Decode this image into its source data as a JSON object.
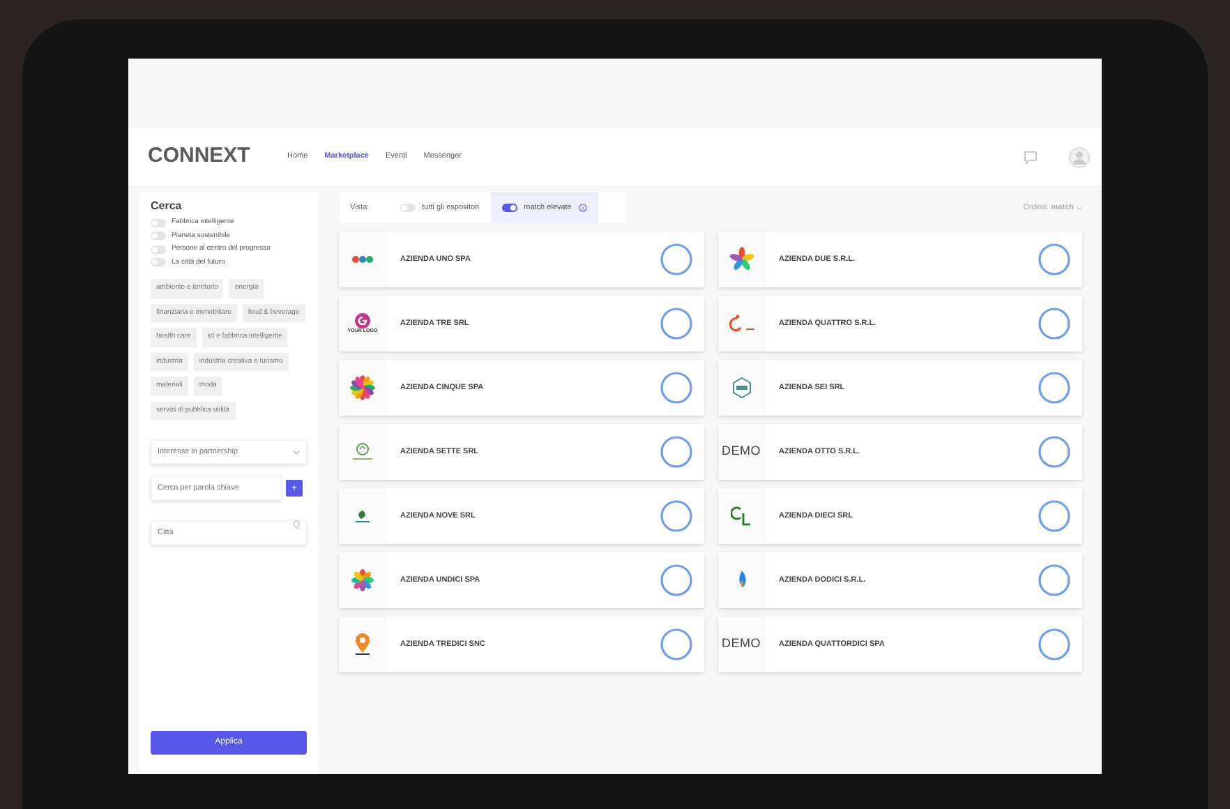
{
  "header": {
    "logo": "CONNEXT",
    "nav": [
      {
        "label": "Home",
        "selected": false
      },
      {
        "label": "Marketplace",
        "selected": true
      },
      {
        "label": "Eventi",
        "selected": false
      },
      {
        "label": "Messenger",
        "selected": false
      }
    ]
  },
  "sidebar": {
    "title": "Cerca",
    "toggles": [
      {
        "label": "Fabbrica intelligente",
        "on": false
      },
      {
        "label": "Pianeta sostenibile",
        "on": false
      },
      {
        "label": "Persone al centro del progresso",
        "on": false
      },
      {
        "label": "La città del futuro",
        "on": false
      }
    ],
    "tags": [
      "ambiente e territorio",
      "energia",
      "finanziaria e immobiliare",
      "food & beverage",
      "health care",
      "ict e fabbrica intelligente",
      "industria",
      "industria creativa e turismo",
      "materiali",
      "moda",
      "servizi di pubblica utilità"
    ],
    "partnership": {
      "placeholder": "Interesse in partnership"
    },
    "keyword": {
      "placeholder": "Cerca per parola chiave",
      "button": "+"
    },
    "city": {
      "placeholder": "Città"
    },
    "apply": "Applica"
  },
  "view": {
    "label": "Vista:",
    "options": [
      {
        "label": "tutti gli espositori",
        "on": false,
        "selected": false
      },
      {
        "label": "match elevate",
        "on": true,
        "selected": true
      }
    ],
    "sort": {
      "label": "Ordina:",
      "value": "match"
    }
  },
  "companies": [
    {
      "name": "AZIENDA UNO SPA",
      "logo": {
        "kind": "dots"
      }
    },
    {
      "name": "AZIENDA DUE S.R.L.",
      "logo": {
        "kind": "petals"
      }
    },
    {
      "name": "AZIENDA TRE SRL",
      "logo": {
        "kind": "letter-g",
        "text": "YOUR LOGO"
      }
    },
    {
      "name": "AZIENDA QUATTRO S.R.L.",
      "logo": {
        "kind": "swirl"
      }
    },
    {
      "name": "AZIENDA CINQUE SPA",
      "logo": {
        "kind": "flower"
      }
    },
    {
      "name": "AZIENDA SEI SRL",
      "logo": {
        "kind": "hexagon"
      }
    },
    {
      "name": "AZIENDA SETTE SRL",
      "logo": {
        "kind": "circle"
      }
    },
    {
      "name": "AZIENDA OTTO S.R.L.",
      "logo": {
        "kind": "wordmark",
        "text": "DEMO"
      }
    },
    {
      "name": "AZIENDA NOVE SRL",
      "logo": {
        "kind": "leaf"
      }
    },
    {
      "name": "AZIENDA DIECI SRL",
      "logo": {
        "kind": "letters"
      }
    },
    {
      "name": "AZIENDA UNDICI SPA",
      "logo": {
        "kind": "pinwheel"
      }
    },
    {
      "name": "AZIENDA DODICI S.R.L.",
      "logo": {
        "kind": "flame"
      }
    },
    {
      "name": "AZIENDA TREDICI SNC",
      "logo": {
        "kind": "pin"
      }
    },
    {
      "name": "AZIENDA QUATTORDICI SPA",
      "logo": {
        "kind": "wordmark",
        "text": "DEMO"
      }
    }
  ]
}
